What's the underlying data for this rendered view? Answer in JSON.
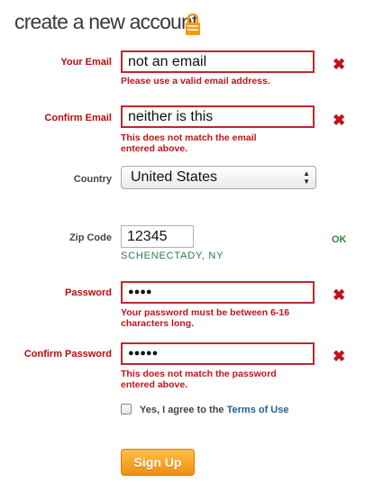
{
  "page": {
    "title": "create a new account"
  },
  "form": {
    "email": {
      "label": "Your Email",
      "value": "not an email",
      "error": "Please use a valid email address.",
      "status_icon": "error-x-icon"
    },
    "confirm_email": {
      "label": "Confirm Email",
      "value": "neither is this",
      "error": "This does not match the email entered above.",
      "status_icon": "error-x-icon"
    },
    "country": {
      "label": "Country",
      "value": "United States"
    },
    "zip": {
      "label": "Zip Code",
      "value": "12345",
      "city": "SCHENECTADY, NY",
      "status": "OK"
    },
    "password": {
      "label": "Password",
      "value": "●●●●",
      "error": "Your password must be between 6-16 characters long.",
      "status_icon": "error-x-icon"
    },
    "confirm_password": {
      "label": "Confirm Password",
      "value": "●●●●●",
      "error": "This does not match the password entered above.",
      "status_icon": "error-x-icon"
    },
    "terms": {
      "text": "Yes, I agree to the",
      "link": "Terms of Use",
      "checked": false
    },
    "submit_label": "Sign Up"
  },
  "icons": {
    "error_mark": "✖"
  },
  "colors": {
    "error": "#c0141a",
    "ok": "#2b8a3b",
    "accent": "#f5a020",
    "link": "#23618f"
  }
}
